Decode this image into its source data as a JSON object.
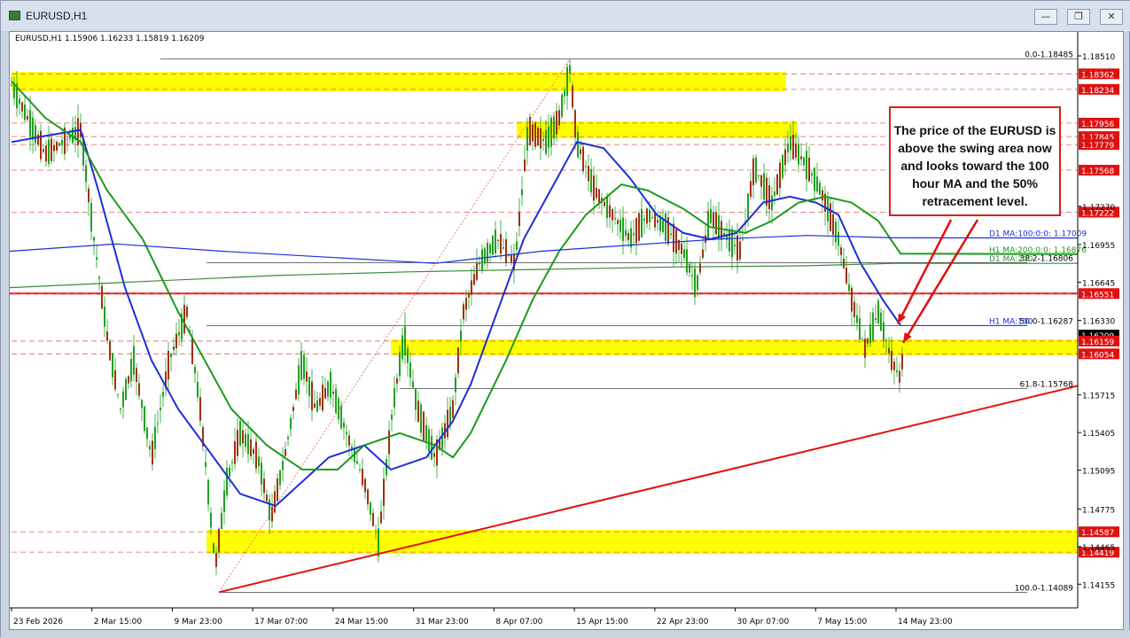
{
  "window": {
    "title": "EURUSD,H1",
    "buttons": [
      "minimize",
      "restore",
      "close"
    ]
  },
  "header_info": "EURUSD,H1  1.15906 1.16233 1.15819 1.16209",
  "note_text": "The price of the EURUSD is above the swing area now and looks toward the 100 hour MA and the 50% retracement level.",
  "colors": {
    "highlight": "#ffff00",
    "trend": "#e01010",
    "ma100": "#1c2fd8",
    "ma200": "#1c9a1c",
    "d1ma100": "#1c2fd8",
    "d1ma200": "#3a8a3a",
    "candle": "#20a020",
    "current_price_tag": "#000000",
    "level_tag": "#e01010"
  },
  "chart_data": {
    "type": "candlestick",
    "symbol": "EURUSD",
    "timeframe": "H1",
    "ohlc": {
      "open": 1.15906,
      "high": 1.16233,
      "low": 1.15819,
      "close": 1.16209
    },
    "ylim": [
      1.1396,
      1.1862
    ],
    "y_ticks": [
      1.1851,
      1.1727,
      1.16955,
      1.16645,
      1.1633,
      1.15715,
      1.15405,
      1.15095,
      1.14775,
      1.14465,
      1.14155
    ],
    "x_ticks": [
      "23 Feb 2026",
      "2 Mar 15:00",
      "9 Mar 23:00",
      "17 Mar 07:00",
      "24 Mar 15:00",
      "31 Mar 23:00",
      "8 Apr 07:00",
      "15 Apr 15:00",
      "22 Apr 23:00",
      "30 Apr 07:00",
      "7 May 15:00",
      "14 May 23:00"
    ],
    "price_tags": [
      {
        "value": 1.18362,
        "label": "1.18362",
        "kind": "level"
      },
      {
        "value": 1.18234,
        "label": "1.18234",
        "kind": "level"
      },
      {
        "value": 1.17956,
        "label": "1.17956",
        "kind": "level"
      },
      {
        "value": 1.17845,
        "label": "1.17845",
        "kind": "level"
      },
      {
        "value": 1.17779,
        "label": "1.17779",
        "kind": "level"
      },
      {
        "value": 1.17568,
        "label": "1.17568",
        "kind": "level"
      },
      {
        "value": 1.17222,
        "label": "1.17222",
        "kind": "level"
      },
      {
        "value": 1.16551,
        "label": "1.16551",
        "kind": "level"
      },
      {
        "value": 1.16209,
        "label": "1.16209",
        "kind": "current"
      },
      {
        "value": 1.16159,
        "label": "1.16159",
        "kind": "level"
      },
      {
        "value": 1.16054,
        "label": "1.16054",
        "kind": "level"
      },
      {
        "value": 1.14587,
        "label": "1.14587",
        "kind": "level"
      },
      {
        "value": 1.14419,
        "label": "1.14419",
        "kind": "level"
      }
    ],
    "fib_levels": [
      {
        "label": "0.0 - 1.18485",
        "value": 1.18485
      },
      {
        "label": "38.2 - 1.16806",
        "value": 1.16806
      },
      {
        "label": "50.0 - 1.16287",
        "value": 1.16287
      },
      {
        "label": "61.8 - 1.15768",
        "value": 1.15768
      },
      {
        "label": "100.0 - 1.14089",
        "value": 1.14089
      }
    ],
    "ma_labels": [
      {
        "label": "D1 MA:100:0:0: 1.17009",
        "value": 1.17009
      },
      {
        "label": "H1 MA:200:0:0: 1.16876",
        "value": 1.16876
      },
      {
        "label": "D1 MA:200",
        "value": 1.168
      },
      {
        "label": "H1 MA:100",
        "value": 1.16287
      }
    ],
    "zones": [
      {
        "from": 1.18234,
        "to": 1.18362
      },
      {
        "from": 1.17845,
        "to": 1.17956
      },
      {
        "from": 1.16054,
        "to": 1.16159
      },
      {
        "from": 1.14419,
        "to": 1.14587
      }
    ],
    "levels": [
      1.16551
    ],
    "trendline": {
      "from": 1.14089,
      "to": 1.16054
    },
    "series": [
      {
        "name": "H1 MA:100",
        "type": "line"
      },
      {
        "name": "H1 MA:200",
        "type": "line"
      },
      {
        "name": "D1 MA:100",
        "type": "line"
      },
      {
        "name": "D1 MA:200",
        "type": "line"
      }
    ]
  }
}
